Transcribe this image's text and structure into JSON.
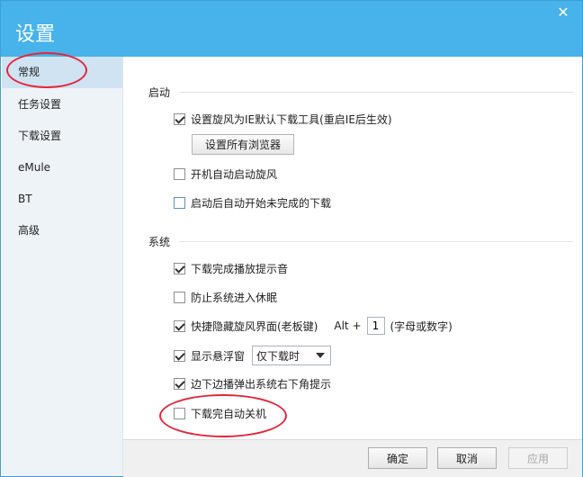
{
  "window": {
    "title": "设置",
    "close_glyph": "✕"
  },
  "sidebar": {
    "items": [
      {
        "label": "常规",
        "selected": true
      },
      {
        "label": "任务设置"
      },
      {
        "label": "下载设置"
      },
      {
        "label": "eMule"
      },
      {
        "label": "BT"
      },
      {
        "label": "高级"
      }
    ]
  },
  "startup": {
    "title": "启动",
    "set_default": {
      "label": "设置旋风为IE默认下载工具(重启IE后生效)",
      "checked": true
    },
    "all_browsers_button": "设置所有浏览器",
    "autostart": {
      "label": "开机自动启动旋风",
      "checked": false
    },
    "resume_unfinished": {
      "label": "启动后自动开始未完成的下载",
      "checked": false
    }
  },
  "system": {
    "title": "系统",
    "play_sound": {
      "label": "下载完成播放提示音",
      "checked": true
    },
    "prevent_sleep": {
      "label": "防止系统进入休眠",
      "checked": false
    },
    "hide_hotkey": {
      "label": "快捷隐藏旋风界面(老板键)",
      "checked": true,
      "modifier": "Alt +",
      "key": "1",
      "hint": "(字母或数字)"
    },
    "float_window": {
      "label": "显示悬浮窗",
      "checked": true,
      "selected_option": "仅下载时"
    },
    "tray_popup": {
      "label": "边下边播弹出系统右下角提示",
      "checked": true
    },
    "auto_shutdown": {
      "label": "下载完自动关机",
      "checked": false
    }
  },
  "footer": {
    "ok": "确定",
    "cancel": "取消",
    "apply": "应用"
  },
  "colors": {
    "titlebar": "#47b3ea",
    "annotation": "#e5263a"
  },
  "icons": {
    "close": "close-icon",
    "dropdown": "chevron-down-icon"
  }
}
